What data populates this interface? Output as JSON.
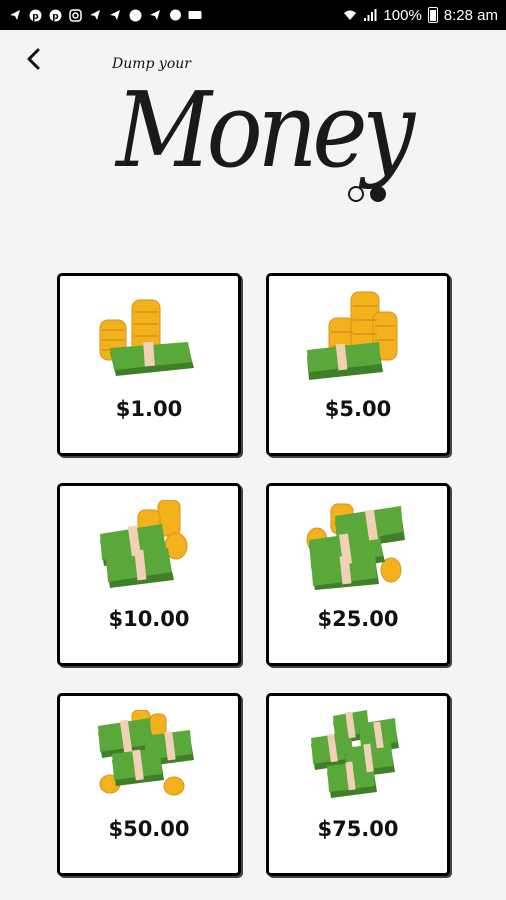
{
  "status_bar": {
    "battery_percent": "100%",
    "time": "8:28 am",
    "icons": [
      "telegram-icon",
      "pinterest-icon",
      "pinterest-icon",
      "instagram-icon",
      "telegram-icon",
      "telegram-icon",
      "viber-icon",
      "telegram-icon",
      "chat-icon",
      "keyboard-icon",
      "wifi-icon",
      "signal-icon",
      "battery-icon"
    ]
  },
  "header": {
    "subtitle": "Dump your",
    "title": "Money",
    "page_indicator": {
      "current": 2,
      "total": 2
    }
  },
  "amounts": [
    {
      "label": "$1.00",
      "icon": "coins-small-stack-icon"
    },
    {
      "label": "$5.00",
      "icon": "coins-stack-icon"
    },
    {
      "label": "$10.00",
      "icon": "cash-bundle-icon"
    },
    {
      "label": "$25.00",
      "icon": "cash-bundle-large-icon"
    },
    {
      "label": "$50.00",
      "icon": "cash-pile-icon"
    },
    {
      "label": "$75.00",
      "icon": "cash-pile-large-icon"
    }
  ],
  "colors": {
    "bill_green": "#5aa83a",
    "bill_dark": "#3f7f27",
    "band": "#f1d1b6",
    "coin": "#f3b21b",
    "coin_dark": "#d8921a"
  }
}
